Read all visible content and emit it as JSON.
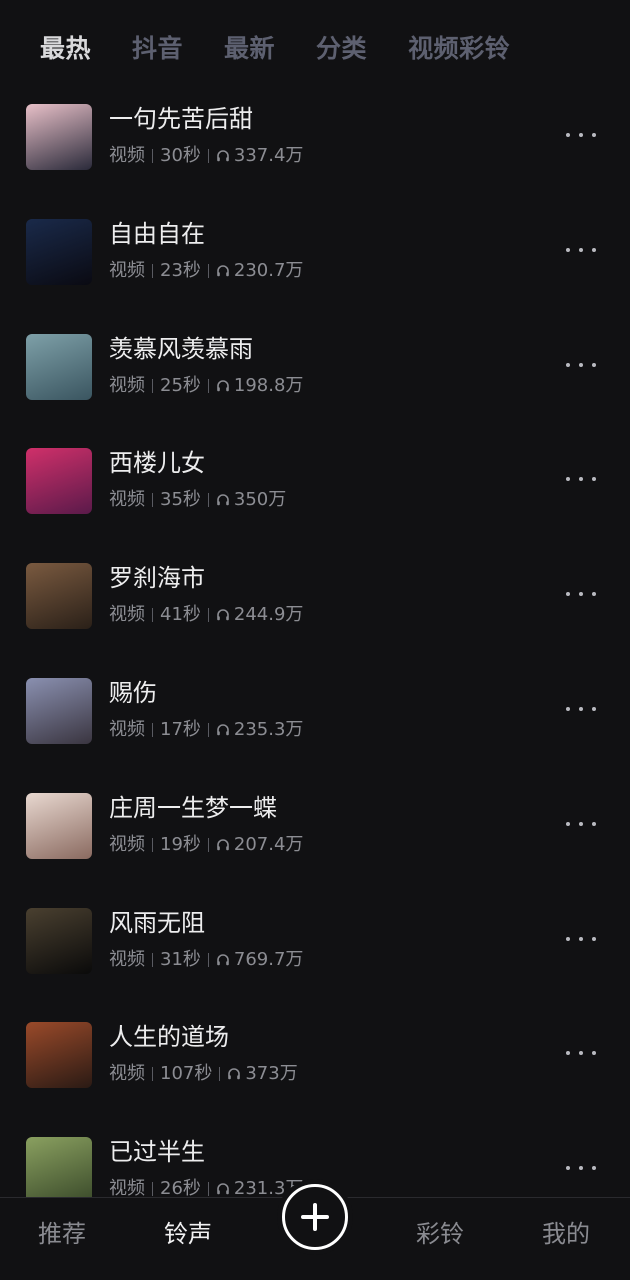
{
  "top_tabs": [
    {
      "label": "最热",
      "active": true
    },
    {
      "label": "抖音",
      "active": false
    },
    {
      "label": "最新",
      "active": false
    },
    {
      "label": "分类",
      "active": false
    },
    {
      "label": "视频彩铃",
      "active": false
    }
  ],
  "ringtones": [
    {
      "title": "一句先苦后甜",
      "type": "视频",
      "duration": "30秒",
      "plays": "337.4万",
      "thumb_colors": [
        "#e8c0c8",
        "#2a2a3a"
      ]
    },
    {
      "title": "自由自在",
      "type": "视频",
      "duration": "23秒",
      "plays": "230.7万",
      "thumb_colors": [
        "#1a2a4a",
        "#0a0a12"
      ]
    },
    {
      "title": "羡慕风羡慕雨",
      "type": "视频",
      "duration": "25秒",
      "plays": "198.8万",
      "thumb_colors": [
        "#7ea0a8",
        "#3a5560"
      ]
    },
    {
      "title": "西楼儿女",
      "type": "视频",
      "duration": "35秒",
      "plays": "350万",
      "thumb_colors": [
        "#d0306a",
        "#5a1a4a"
      ]
    },
    {
      "title": "罗刹海市",
      "type": "视频",
      "duration": "41秒",
      "plays": "244.9万",
      "thumb_colors": [
        "#7a5a40",
        "#2a2018"
      ]
    },
    {
      "title": "赐伤",
      "type": "视频",
      "duration": "17秒",
      "plays": "235.3万",
      "thumb_colors": [
        "#8a90b0",
        "#3a3540"
      ]
    },
    {
      "title": "庄周一生梦一蝶",
      "type": "视频",
      "duration": "19秒",
      "plays": "207.4万",
      "thumb_colors": [
        "#e8d8d0",
        "#8a6a60"
      ]
    },
    {
      "title": "风雨无阻",
      "type": "视频",
      "duration": "31秒",
      "plays": "769.7万",
      "thumb_colors": [
        "#4a4030",
        "#0a0a0a"
      ]
    },
    {
      "title": "人生的道场",
      "type": "视频",
      "duration": "107秒",
      "plays": "373万",
      "thumb_colors": [
        "#9a4a2a",
        "#2a1a14"
      ]
    },
    {
      "title": "已过半生",
      "type": "视频",
      "duration": "26秒",
      "plays": "231.3万",
      "thumb_colors": [
        "#8aa060",
        "#3a4a2a"
      ]
    }
  ],
  "bottom_nav": [
    {
      "label": "推荐",
      "active": false
    },
    {
      "label": "铃声",
      "active": true
    },
    {
      "label": "彩铃",
      "active": false
    },
    {
      "label": "我的",
      "active": false
    }
  ],
  "icons": {
    "add": "plus-circle-icon",
    "more": "more-dots-icon",
    "plays": "headphone-icon"
  }
}
